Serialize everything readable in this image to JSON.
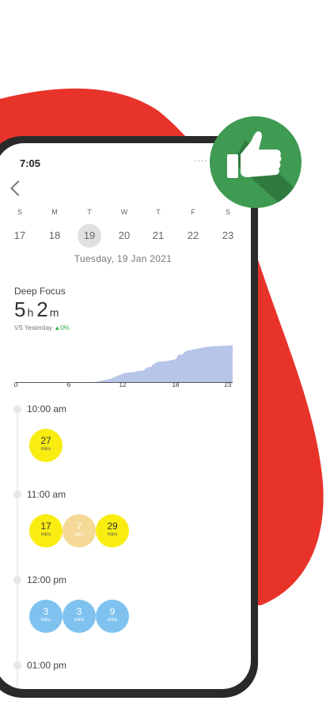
{
  "colors": {
    "blob": "#e8332a",
    "phone_frame": "#2a2a2a",
    "badge": "#3f9a52",
    "chart_fill": "#b7c6e8",
    "bubble_yellow": "#f8ec11",
    "bubble_tan": "#f5d996",
    "bubble_blue": "#7fc2ef",
    "trend_up": "#2bb24c"
  },
  "badge_icon": "thumbs-up-icon",
  "status": {
    "time": "7:05",
    "dots": "...."
  },
  "nav": {
    "back_icon": "back-chevron-icon"
  },
  "week": {
    "days": [
      "S",
      "M",
      "T",
      "W",
      "T",
      "F",
      "S"
    ],
    "dates": [
      "17",
      "18",
      "19",
      "20",
      "21",
      "22",
      "23"
    ],
    "selected_index": 2
  },
  "selected_date": "Tuesday, 19 Jan 2021",
  "deep_focus": {
    "title": "Deep Focus",
    "hours": "5",
    "hours_unit": "h",
    "minutes": "2",
    "minutes_unit": "m",
    "vs_label": "VS Yesterday",
    "trend_arrow": "▲",
    "trend_value": "0%"
  },
  "chart_data": {
    "type": "area",
    "x_ticks": [
      "0",
      "6",
      "12",
      "18",
      "23"
    ],
    "x": [
      0,
      8,
      10,
      11.5,
      12.5,
      13,
      13.5,
      14,
      14.3,
      14.6,
      15,
      16,
      17,
      17.2,
      17.7,
      18,
      19,
      20,
      21,
      23
    ],
    "y": [
      0,
      0,
      0.2,
      0.5,
      0.55,
      0.6,
      0.62,
      0.8,
      0.8,
      0.95,
      1.05,
      1.1,
      1.2,
      1.4,
      1.45,
      1.6,
      1.7,
      1.8,
      1.85,
      1.9
    ],
    "xlim": [
      0,
      23
    ]
  },
  "timeline": [
    {
      "time": "10:00 am",
      "sessions": [
        {
          "value": "27",
          "unit": "mins",
          "color": "yellow"
        }
      ]
    },
    {
      "time": "11:00 am",
      "sessions": [
        {
          "value": "17",
          "unit": "mins",
          "color": "yellow"
        },
        {
          "value": "7",
          "unit": "mins",
          "color": "tan"
        },
        {
          "value": "29",
          "unit": "mins",
          "color": "yellow"
        }
      ]
    },
    {
      "time": "12:00 pm",
      "sessions": [
        {
          "value": "3",
          "unit": "mins",
          "color": "blue"
        },
        {
          "value": "3",
          "unit": "mins",
          "color": "blue"
        },
        {
          "value": "9",
          "unit": "mins",
          "color": "blue"
        }
      ]
    },
    {
      "time": "01:00 pm",
      "sessions": []
    }
  ]
}
